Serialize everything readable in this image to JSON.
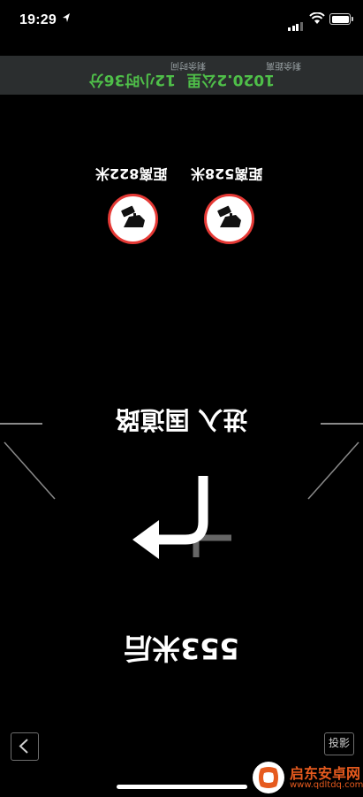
{
  "status_bar": {
    "time": "19:29"
  },
  "info_panel": {
    "remaining_distance_label": "剩余距离",
    "remaining_time_label": "剩余时间",
    "remaining_distance_value": "1020.2公里",
    "remaining_time_value": "12小时36分"
  },
  "cameras": [
    {
      "distance": "距离822米",
      "icon": "speed-camera-icon"
    },
    {
      "distance": "距离528米",
      "icon": "speed-camera-icon"
    }
  ],
  "navigation": {
    "road_name": "进入 国道路",
    "distance": "553米后",
    "turn_direction": "turn-left-icon"
  },
  "controls": {
    "project_label": "投影"
  },
  "watermark": {
    "title": "启东安卓网",
    "url": "www.qdltdq.com"
  },
  "colors": {
    "background": "#000000",
    "panel": "#2b2e2f",
    "accent_green": "#4fbf49",
    "camera_red": "#e53935"
  }
}
